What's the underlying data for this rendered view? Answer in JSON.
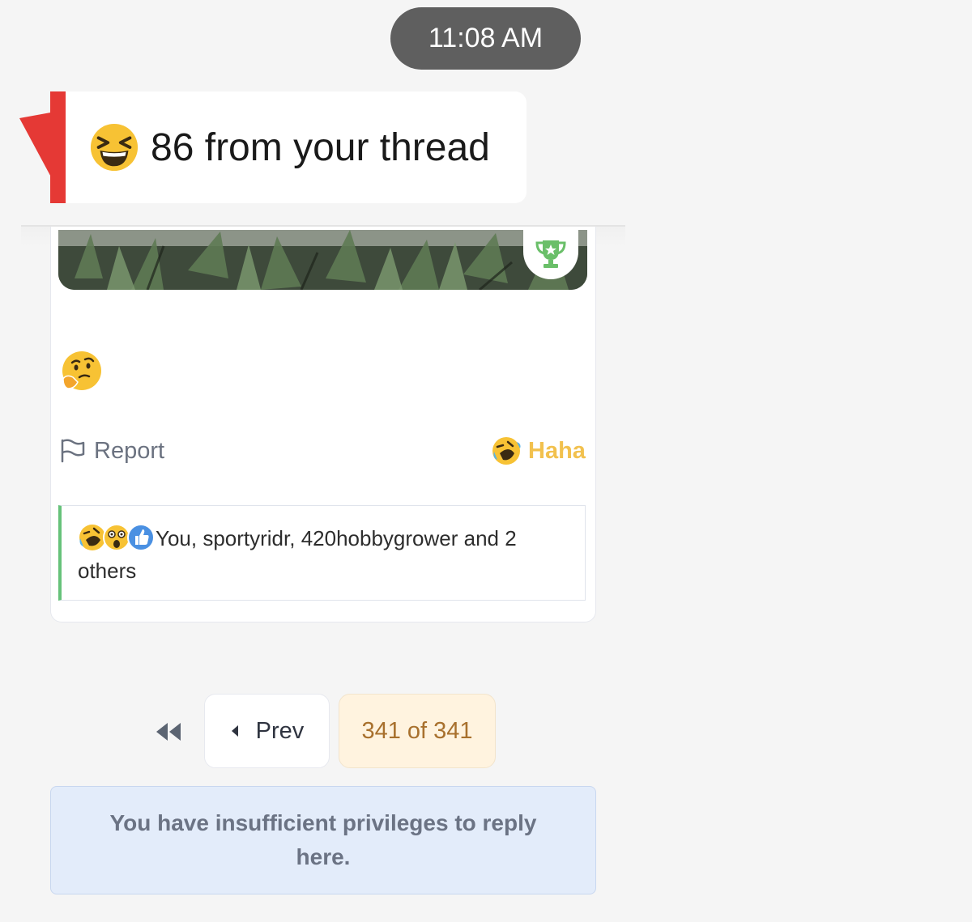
{
  "status": {
    "time": "11:08 AM"
  },
  "toast": {
    "emoji": "grinning-squinting-face",
    "message": "86 from your thread",
    "accent_color": "#e53935"
  },
  "post": {
    "image_alt": "cannabis plant leaves",
    "badge_icon": "trophy-icon",
    "body_emoji": "thinking-face",
    "report_label": "Report",
    "reaction_label": "Haha",
    "reaction_color": "#f2c14e",
    "reactions_summary": {
      "icons": [
        "rolling-on-floor-laughing",
        "astonished-face",
        "thumbs-up"
      ],
      "text": "You, sportyridr, 420hobbygrower and 2 others"
    }
  },
  "pagination": {
    "prev_label": "Prev",
    "indicator": "341 of 341"
  },
  "notice": {
    "text": "You have insufficient privileges to reply here."
  }
}
